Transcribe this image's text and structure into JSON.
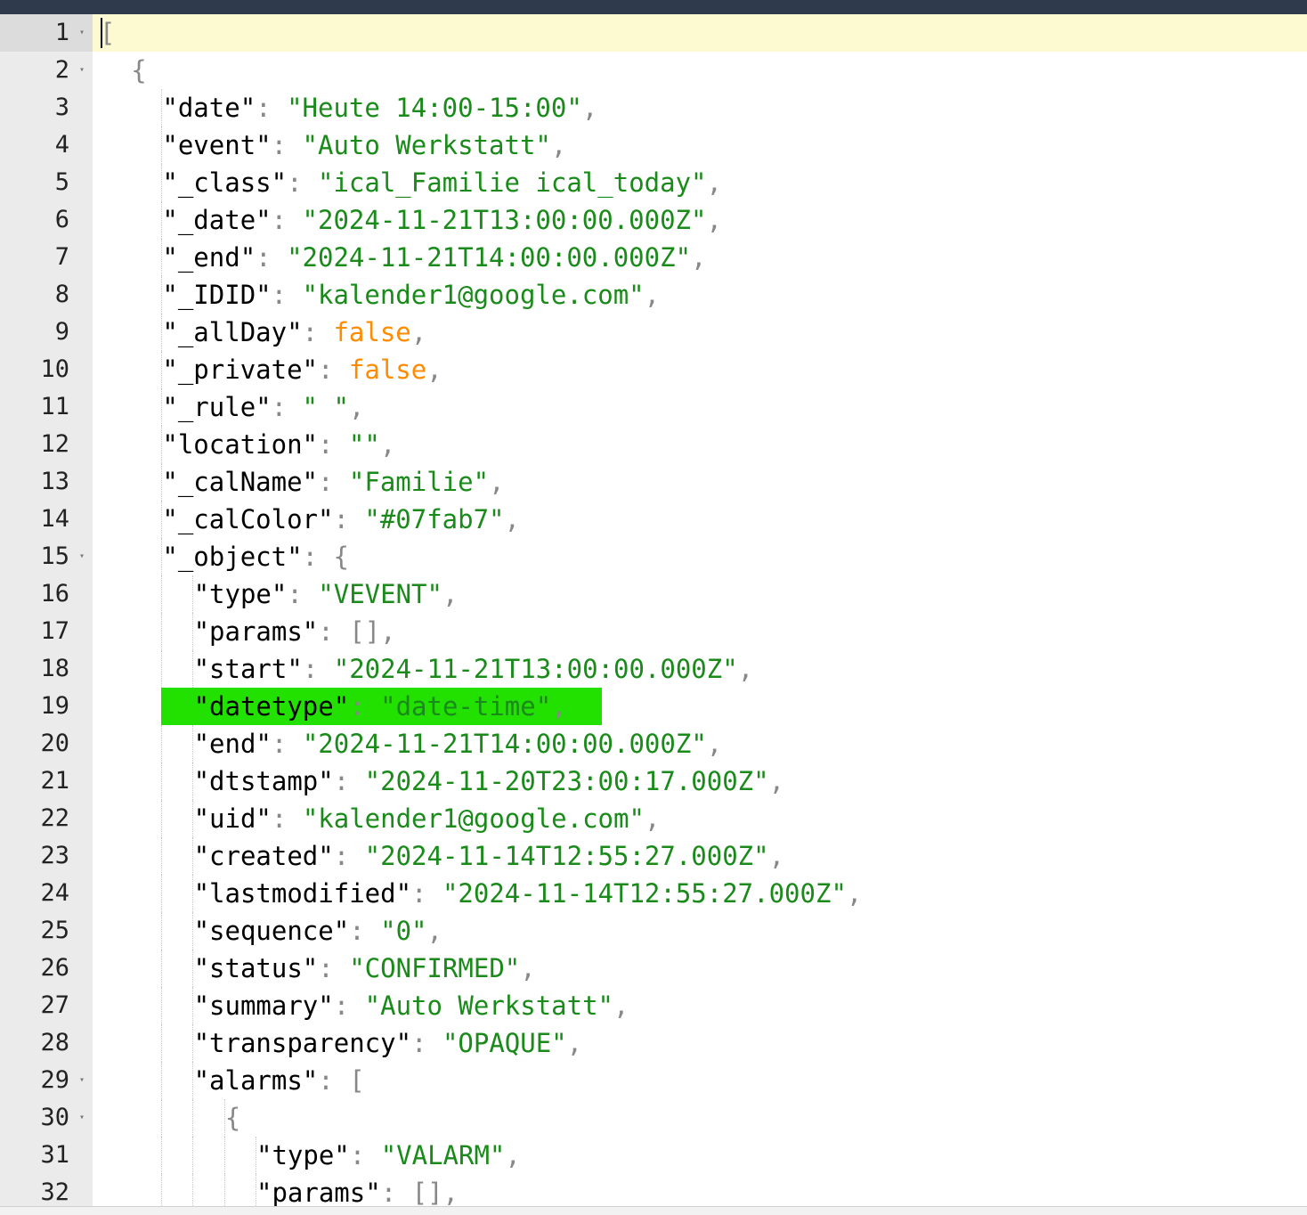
{
  "editor": {
    "document": "JSON",
    "lines": [
      {
        "n": "1",
        "fold": true,
        "indent": 0,
        "tokens": [
          {
            "t": "[",
            "c": "p"
          }
        ]
      },
      {
        "n": "2",
        "fold": true,
        "indent": 1,
        "tokens": [
          {
            "t": "{",
            "c": "p"
          }
        ]
      },
      {
        "n": "3",
        "fold": false,
        "indent": 2,
        "tokens": [
          {
            "t": "\"date\"",
            "c": "k"
          },
          {
            "t": ": ",
            "c": "p"
          },
          {
            "t": "\"Heute 14:00-15:00\"",
            "c": "s"
          },
          {
            "t": ",",
            "c": "p"
          }
        ]
      },
      {
        "n": "4",
        "fold": false,
        "indent": 2,
        "tokens": [
          {
            "t": "\"event\"",
            "c": "k"
          },
          {
            "t": ": ",
            "c": "p"
          },
          {
            "t": "\"Auto Werkstatt\"",
            "c": "s"
          },
          {
            "t": ",",
            "c": "p"
          }
        ]
      },
      {
        "n": "5",
        "fold": false,
        "indent": 2,
        "tokens": [
          {
            "t": "\"_class\"",
            "c": "k"
          },
          {
            "t": ": ",
            "c": "p"
          },
          {
            "t": "\"ical_Familie ical_today\"",
            "c": "s"
          },
          {
            "t": ",",
            "c": "p"
          }
        ]
      },
      {
        "n": "6",
        "fold": false,
        "indent": 2,
        "tokens": [
          {
            "t": "\"_date\"",
            "c": "k"
          },
          {
            "t": ": ",
            "c": "p"
          },
          {
            "t": "\"2024-11-21T13:00:00.000Z\"",
            "c": "s"
          },
          {
            "t": ",",
            "c": "p"
          }
        ]
      },
      {
        "n": "7",
        "fold": false,
        "indent": 2,
        "tokens": [
          {
            "t": "\"_end\"",
            "c": "k"
          },
          {
            "t": ": ",
            "c": "p"
          },
          {
            "t": "\"2024-11-21T14:00:00.000Z\"",
            "c": "s"
          },
          {
            "t": ",",
            "c": "p"
          }
        ]
      },
      {
        "n": "8",
        "fold": false,
        "indent": 2,
        "tokens": [
          {
            "t": "\"_IDID\"",
            "c": "k"
          },
          {
            "t": ": ",
            "c": "p"
          },
          {
            "t": "\"kalender1@google.com\"",
            "c": "s"
          },
          {
            "t": ",",
            "c": "p"
          }
        ]
      },
      {
        "n": "9",
        "fold": false,
        "indent": 2,
        "tokens": [
          {
            "t": "\"_allDay\"",
            "c": "k"
          },
          {
            "t": ": ",
            "c": "p"
          },
          {
            "t": "false",
            "c": "b"
          },
          {
            "t": ",",
            "c": "p"
          }
        ]
      },
      {
        "n": "10",
        "fold": false,
        "indent": 2,
        "tokens": [
          {
            "t": "\"_private\"",
            "c": "k"
          },
          {
            "t": ": ",
            "c": "p"
          },
          {
            "t": "false",
            "c": "b"
          },
          {
            "t": ",",
            "c": "p"
          }
        ]
      },
      {
        "n": "11",
        "fold": false,
        "indent": 2,
        "tokens": [
          {
            "t": "\"_rule\"",
            "c": "k"
          },
          {
            "t": ": ",
            "c": "p"
          },
          {
            "t": "\" \"",
            "c": "s"
          },
          {
            "t": ",",
            "c": "p"
          }
        ]
      },
      {
        "n": "12",
        "fold": false,
        "indent": 2,
        "tokens": [
          {
            "t": "\"location\"",
            "c": "k"
          },
          {
            "t": ": ",
            "c": "p"
          },
          {
            "t": "\"\"",
            "c": "s"
          },
          {
            "t": ",",
            "c": "p"
          }
        ]
      },
      {
        "n": "13",
        "fold": false,
        "indent": 2,
        "tokens": [
          {
            "t": "\"_calName\"",
            "c": "k"
          },
          {
            "t": ": ",
            "c": "p"
          },
          {
            "t": "\"Familie\"",
            "c": "s"
          },
          {
            "t": ",",
            "c": "p"
          }
        ]
      },
      {
        "n": "14",
        "fold": false,
        "indent": 2,
        "tokens": [
          {
            "t": "\"_calColor\"",
            "c": "k"
          },
          {
            "t": ": ",
            "c": "p"
          },
          {
            "t": "\"#07fab7\"",
            "c": "s"
          },
          {
            "t": ",",
            "c": "p"
          }
        ]
      },
      {
        "n": "15",
        "fold": true,
        "indent": 2,
        "tokens": [
          {
            "t": "\"_object\"",
            "c": "k"
          },
          {
            "t": ": {",
            "c": "p"
          }
        ]
      },
      {
        "n": "16",
        "fold": false,
        "indent": 3,
        "tokens": [
          {
            "t": "\"type\"",
            "c": "k"
          },
          {
            "t": ": ",
            "c": "p"
          },
          {
            "t": "\"VEVENT\"",
            "c": "s"
          },
          {
            "t": ",",
            "c": "p"
          }
        ]
      },
      {
        "n": "17",
        "fold": false,
        "indent": 3,
        "tokens": [
          {
            "t": "\"params\"",
            "c": "k"
          },
          {
            "t": ": [],",
            "c": "p"
          }
        ]
      },
      {
        "n": "18",
        "fold": false,
        "indent": 3,
        "tokens": [
          {
            "t": "\"start\"",
            "c": "k"
          },
          {
            "t": ": ",
            "c": "p"
          },
          {
            "t": "\"2024-11-21T13:00:00.000Z\"",
            "c": "s"
          },
          {
            "t": ",",
            "c": "p"
          }
        ]
      },
      {
        "n": "19",
        "fold": false,
        "indent": 3,
        "highlight": true,
        "tokens": [
          {
            "t": "\"datetype\"",
            "c": "k"
          },
          {
            "t": ": ",
            "c": "p"
          },
          {
            "t": "\"date-time\"",
            "c": "s"
          },
          {
            "t": ",",
            "c": "p"
          }
        ]
      },
      {
        "n": "20",
        "fold": false,
        "indent": 3,
        "tokens": [
          {
            "t": "\"end\"",
            "c": "k"
          },
          {
            "t": ": ",
            "c": "p"
          },
          {
            "t": "\"2024-11-21T14:00:00.000Z\"",
            "c": "s"
          },
          {
            "t": ",",
            "c": "p"
          }
        ]
      },
      {
        "n": "21",
        "fold": false,
        "indent": 3,
        "tokens": [
          {
            "t": "\"dtstamp\"",
            "c": "k"
          },
          {
            "t": ": ",
            "c": "p"
          },
          {
            "t": "\"2024-11-20T23:00:17.000Z\"",
            "c": "s"
          },
          {
            "t": ",",
            "c": "p"
          }
        ]
      },
      {
        "n": "22",
        "fold": false,
        "indent": 3,
        "tokens": [
          {
            "t": "\"uid\"",
            "c": "k"
          },
          {
            "t": ": ",
            "c": "p"
          },
          {
            "t": "\"kalender1@google.com\"",
            "c": "s"
          },
          {
            "t": ",",
            "c": "p"
          }
        ]
      },
      {
        "n": "23",
        "fold": false,
        "indent": 3,
        "tokens": [
          {
            "t": "\"created\"",
            "c": "k"
          },
          {
            "t": ": ",
            "c": "p"
          },
          {
            "t": "\"2024-11-14T12:55:27.000Z\"",
            "c": "s"
          },
          {
            "t": ",",
            "c": "p"
          }
        ]
      },
      {
        "n": "24",
        "fold": false,
        "indent": 3,
        "tokens": [
          {
            "t": "\"lastmodified\"",
            "c": "k"
          },
          {
            "t": ": ",
            "c": "p"
          },
          {
            "t": "\"2024-11-14T12:55:27.000Z\"",
            "c": "s"
          },
          {
            "t": ",",
            "c": "p"
          }
        ]
      },
      {
        "n": "25",
        "fold": false,
        "indent": 3,
        "tokens": [
          {
            "t": "\"sequence\"",
            "c": "k"
          },
          {
            "t": ": ",
            "c": "p"
          },
          {
            "t": "\"0\"",
            "c": "s"
          },
          {
            "t": ",",
            "c": "p"
          }
        ]
      },
      {
        "n": "26",
        "fold": false,
        "indent": 3,
        "tokens": [
          {
            "t": "\"status\"",
            "c": "k"
          },
          {
            "t": ": ",
            "c": "p"
          },
          {
            "t": "\"CONFIRMED\"",
            "c": "s"
          },
          {
            "t": ",",
            "c": "p"
          }
        ]
      },
      {
        "n": "27",
        "fold": false,
        "indent": 3,
        "tokens": [
          {
            "t": "\"summary\"",
            "c": "k"
          },
          {
            "t": ": ",
            "c": "p"
          },
          {
            "t": "\"Auto Werkstatt\"",
            "c": "s"
          },
          {
            "t": ",",
            "c": "p"
          }
        ]
      },
      {
        "n": "28",
        "fold": false,
        "indent": 3,
        "tokens": [
          {
            "t": "\"transparency\"",
            "c": "k"
          },
          {
            "t": ": ",
            "c": "p"
          },
          {
            "t": "\"OPAQUE\"",
            "c": "s"
          },
          {
            "t": ",",
            "c": "p"
          }
        ]
      },
      {
        "n": "29",
        "fold": true,
        "indent": 3,
        "tokens": [
          {
            "t": "\"alarms\"",
            "c": "k"
          },
          {
            "t": ": [",
            "c": "p"
          }
        ]
      },
      {
        "n": "30",
        "fold": true,
        "indent": 4,
        "tokens": [
          {
            "t": "{",
            "c": "p"
          }
        ]
      },
      {
        "n": "31",
        "fold": false,
        "indent": 5,
        "tokens": [
          {
            "t": "\"type\"",
            "c": "k"
          },
          {
            "t": ": ",
            "c": "p"
          },
          {
            "t": "\"VALARM\"",
            "c": "s"
          },
          {
            "t": ",",
            "c": "p"
          }
        ]
      },
      {
        "n": "32",
        "fold": false,
        "indent": 5,
        "tokens": [
          {
            "t": "\"params\"",
            "c": "k"
          },
          {
            "t": ": [],",
            "c": "p"
          }
        ]
      }
    ]
  },
  "icons": {
    "fold_marker": "chevron-down-icon",
    "fold_glyph": "▾"
  },
  "colors": {
    "key": "#000000",
    "string": "#1a8a1a",
    "boolean": "#ff8c00",
    "punctuation": "#888888",
    "active_line": "#fdf9d0",
    "highlight": "#22e000",
    "gutter": "#ebebeb",
    "topbar": "#2f3b4c"
  },
  "state": {
    "active_line": 1,
    "highlighted_line": 19
  }
}
